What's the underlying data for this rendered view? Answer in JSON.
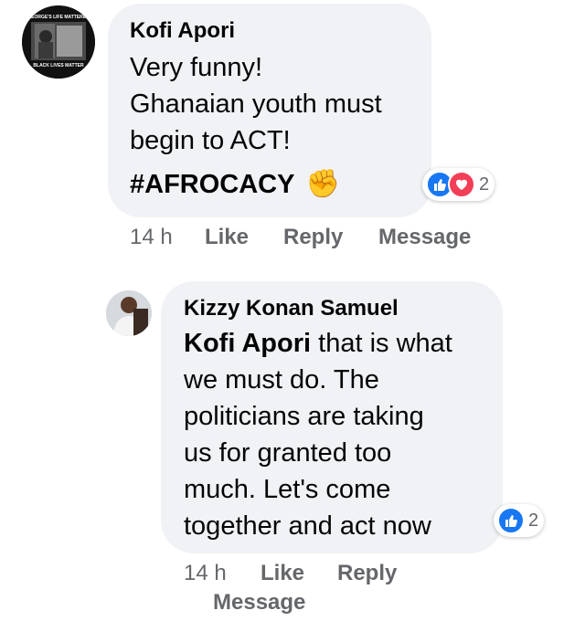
{
  "comments": [
    {
      "author": "Kofi Apori",
      "avatar_text_top": "GEORGE'S LIFE MATTERED",
      "avatar_text_bottom": "BLACK LIVES MATTER",
      "lines": [
        "Very funny!",
        "Ghanaian youth must",
        "begin to ACT!"
      ],
      "hashtag": "#AFROCACY",
      "hashtag_emoji": "✊",
      "reactions": {
        "icons": [
          "like-icon",
          "love-icon"
        ],
        "count": "2"
      },
      "time": "14 h",
      "actions": [
        "Like",
        "Reply",
        "Message"
      ]
    },
    {
      "author": "Kizzy Konan Samuel",
      "mention": "Kofi Apori",
      "first_line_rest": " that is what",
      "lines": [
        "we must do. The",
        "politicians are taking",
        "us for granted too",
        "much. Let's come",
        "together and act now"
      ],
      "reactions": {
        "icons": [
          "like-icon"
        ],
        "count": "2"
      },
      "time": "14 h",
      "actions": [
        "Like",
        "Reply",
        "Message"
      ]
    }
  ],
  "colors": {
    "bubble": "#f0f2f5",
    "meta": "#65676b",
    "like": "#1877f2",
    "love": "#f33e58"
  }
}
